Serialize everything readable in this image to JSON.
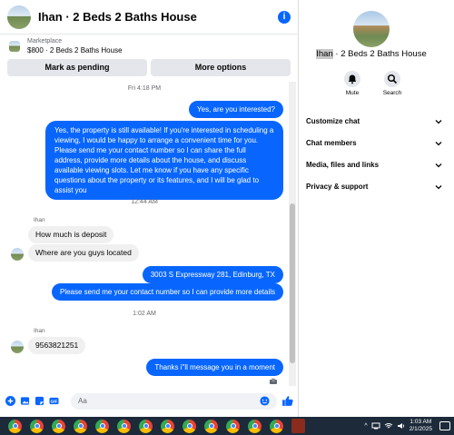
{
  "header": {
    "title": "Ihan · 2 Beds 2 Baths House"
  },
  "listing": {
    "label": "Marketplace",
    "price_title": "$800 · 2 Beds 2 Baths House"
  },
  "actions": {
    "pending_label": "Mark as pending",
    "more_label": "More options"
  },
  "timestamps": {
    "t1": "Fri 4:18 PM",
    "t2": "12:44 AM",
    "t3": "1:02 AM"
  },
  "messages": {
    "m1": "Yes, are you interested?",
    "m2": "Yes, the property is still available! If you're interested in scheduling a viewing, I would be happy to arrange a convenient time for you. Please send me your contact number so I can share the full address, provide more details about the house, and discuss available viewing slots. Let me know if you have any specific questions about the property or its features, and I will be glad to assist you",
    "sender1": "Ihan",
    "m3": "How much is deposit",
    "m4": "Where are you guys located",
    "m5": "3003 S Expressway 281, Edinburg, TX",
    "m6": "Please send me your contact number so I can provide more details",
    "sender2": "Ihan",
    "m7": "9563821251",
    "m8": "Thanks i\"ll message you in a moment"
  },
  "composer": {
    "placeholder": "Aa"
  },
  "side": {
    "name_highlight": "Ihan",
    "name_rest": " · 2 Beds 2 Baths House",
    "mute_label": "Mute",
    "search_label": "Search",
    "menu": [
      "Customize chat",
      "Chat members",
      "Media, files and links",
      "Privacy & support"
    ]
  },
  "taskbar": {
    "time": "1:03 AM",
    "date": "2/1/2025"
  },
  "colors": {
    "accent": "#0866ff",
    "bubble_in": "#f0f0f0",
    "taskbar": "#1c2a3a"
  },
  "icons": [
    "info-icon",
    "bell-icon",
    "search-icon",
    "chevron-down-icon",
    "plus-icon",
    "image-icon",
    "sticker-icon",
    "gif-icon",
    "emoji-icon",
    "like-icon",
    "chrome-icon",
    "wifi-icon",
    "volume-icon",
    "notification-icon"
  ]
}
